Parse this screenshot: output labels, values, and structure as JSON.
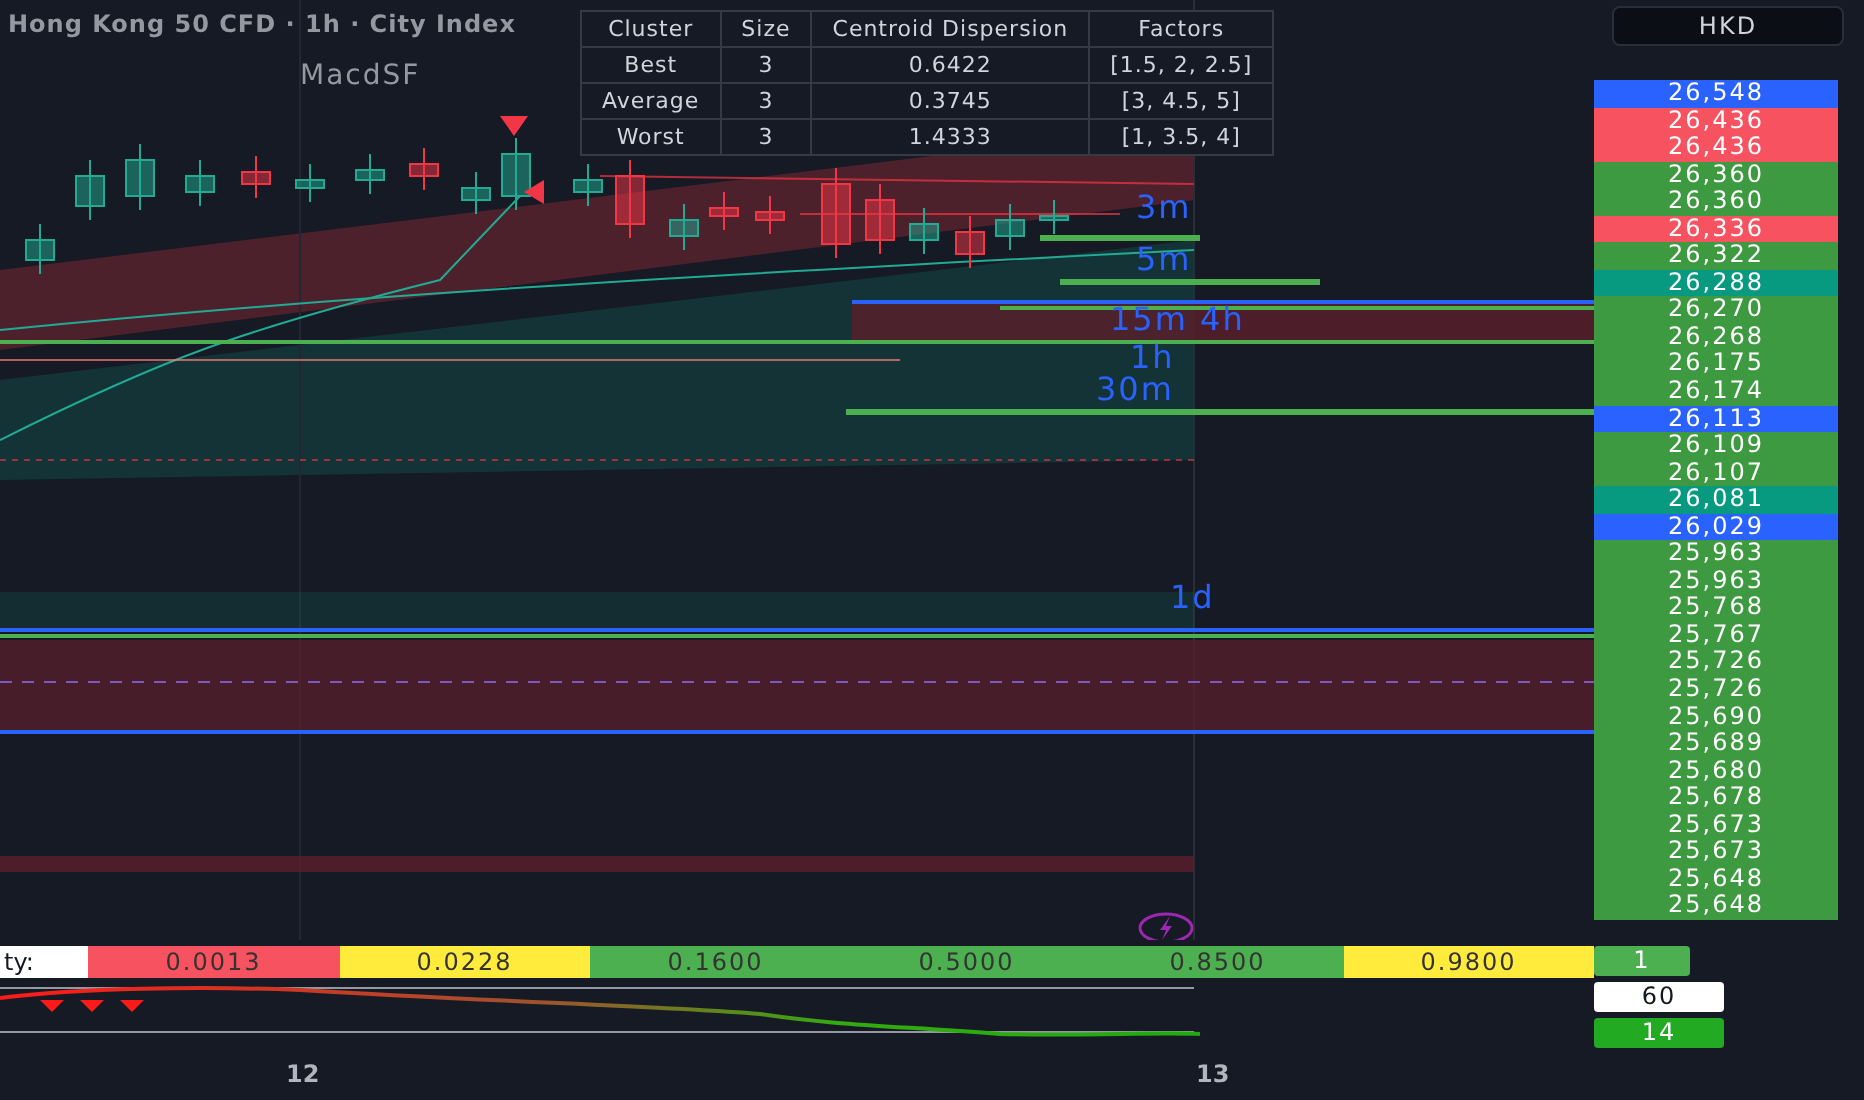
{
  "header": {
    "title": "Hong Kong 50 CFD · 1h · City Index",
    "currency": "HKD"
  },
  "cluster_table": {
    "columns": [
      "Cluster",
      "Size",
      "Centroid Dispersion",
      "Factors"
    ],
    "rows": [
      {
        "cluster": "Best",
        "size": "3",
        "dispersion": "0.6422",
        "factors": "[1.5, 2, 2.5]"
      },
      {
        "cluster": "Average",
        "size": "3",
        "dispersion": "0.3745",
        "factors": "[3, 4.5, 5]"
      },
      {
        "cluster": "Worst",
        "size": "3",
        "dispersion": "1.4333",
        "factors": "[1, 3.5, 4]"
      }
    ]
  },
  "chart": {
    "indicator_label": "MacdSF",
    "level_labels": [
      "3m",
      "5m",
      "15m 4h",
      "1h",
      "30m",
      "1d"
    ]
  },
  "price_axis": {
    "labels": [
      {
        "text": "26,548",
        "color": "#2962ff"
      },
      {
        "text": "26,436",
        "color": "#f7525f"
      },
      {
        "text": "26,436",
        "color": "#f7525f"
      },
      {
        "text": "26,360",
        "color": "#3d9a40"
      },
      {
        "text": "26,360",
        "color": "#3d9a40"
      },
      {
        "text": "26,336",
        "color": "#f7525f"
      },
      {
        "text": "26,322",
        "color": "#3d9a40"
      },
      {
        "text": "26,288",
        "color": "#089981"
      },
      {
        "text": "26,270",
        "color": "#3d9a40"
      },
      {
        "text": "26,268",
        "color": "#3d9a40"
      },
      {
        "text": "26,175",
        "color": "#3d9a40"
      },
      {
        "text": "26,174",
        "color": "#3d9a40"
      },
      {
        "text": "26,113",
        "color": "#2962ff"
      },
      {
        "text": "26,109",
        "color": "#3d9a40"
      },
      {
        "text": "26,107",
        "color": "#3d9a40"
      },
      {
        "text": "26,081",
        "color": "#089981"
      },
      {
        "text": "26,029",
        "color": "#2962ff"
      },
      {
        "text": "25,963",
        "color": "#3d9a40"
      },
      {
        "text": "25,963",
        "color": "#3d9a40"
      },
      {
        "text": "25,768",
        "color": "#3d9a40"
      },
      {
        "text": "25,767",
        "color": "#3d9a40"
      },
      {
        "text": "25,726",
        "color": "#3d9a40"
      },
      {
        "text": "25,726",
        "color": "#3d9a40"
      },
      {
        "text": "25,690",
        "color": "#3d9a40"
      },
      {
        "text": "25,689",
        "color": "#3d9a40"
      },
      {
        "text": "25,680",
        "color": "#3d9a40"
      },
      {
        "text": "25,678",
        "color": "#3d9a40"
      },
      {
        "text": "25,673",
        "color": "#3d9a40"
      },
      {
        "text": "25,673",
        "color": "#3d9a40"
      },
      {
        "text": "25,648",
        "color": "#3d9a40"
      },
      {
        "text": "25,648",
        "color": "#3d9a40"
      }
    ]
  },
  "probability_strip": {
    "label": "ty:",
    "cells": [
      {
        "text": "0.0013",
        "color": "#f7525f"
      },
      {
        "text": "0.0228",
        "color": "#ffeb3b"
      },
      {
        "text": "0.1600",
        "color": "#4caf50"
      },
      {
        "text": "0.5000",
        "color": "#4caf50"
      },
      {
        "text": "0.8500",
        "color": "#4caf50"
      },
      {
        "text": "0.9800",
        "color": "#ffeb3b"
      }
    ]
  },
  "side_badges": [
    {
      "text": "1",
      "color": "#4caf50"
    },
    {
      "text": "60",
      "color": "#ffffff"
    },
    {
      "text": "14",
      "color": "#22ab22"
    }
  ],
  "time_axis": [
    "12",
    "13"
  ]
}
